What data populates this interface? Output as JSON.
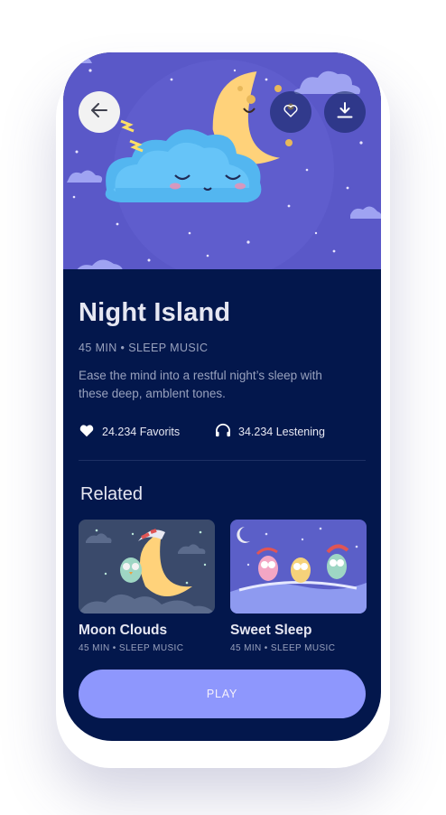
{
  "track": {
    "title": "Night Island",
    "meta": "45 MIN • SLEEP MUSIC",
    "description": "Ease the mind into a restful night’s sleep  with these deep, amblent tones.",
    "favorites": "24.234 Favorits",
    "listening": "34.234 Lestening"
  },
  "related": {
    "heading": "Related",
    "items": [
      {
        "title": "Moon Clouds",
        "meta": "45 MIN • SLEEP MUSIC"
      },
      {
        "title": "Sweet Sleep",
        "meta": "45 MIN • SLEEP MUSIC"
      }
    ]
  },
  "actions": {
    "play_label": "PLAY",
    "back_icon": "arrow-left-icon",
    "favorite_icon": "heart-icon",
    "download_icon": "download-icon"
  },
  "colors": {
    "background": "#03174C",
    "accent": "#8E97FD",
    "hero_sky": "#5A58C8",
    "text_primary": "#E6E7F2",
    "text_secondary": "#98A1BD"
  }
}
